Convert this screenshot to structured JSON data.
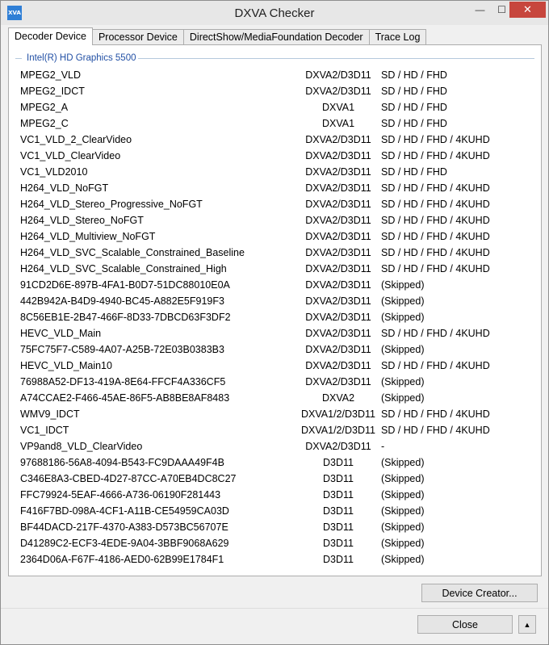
{
  "window": {
    "title": "DXVA Checker",
    "icon_label": "XVA"
  },
  "title_buttons": {
    "minimize": "—",
    "maximize": "☐",
    "close": "✕"
  },
  "tabs": [
    {
      "label": "Decoder Device"
    },
    {
      "label": "Processor Device"
    },
    {
      "label": "DirectShow/MediaFoundation Decoder"
    },
    {
      "label": "Trace Log"
    }
  ],
  "group_title": "Intel(R) HD Graphics 5500",
  "decoders": [
    {
      "name": "MPEG2_VLD",
      "api": "DXVA2/D3D11",
      "res": "SD / HD / FHD"
    },
    {
      "name": "MPEG2_IDCT",
      "api": "DXVA2/D3D11",
      "res": "SD / HD / FHD"
    },
    {
      "name": "MPEG2_A",
      "api": "DXVA1",
      "res": "SD / HD / FHD"
    },
    {
      "name": "MPEG2_C",
      "api": "DXVA1",
      "res": "SD / HD / FHD"
    },
    {
      "name": "VC1_VLD_2_ClearVideo",
      "api": "DXVA2/D3D11",
      "res": "SD / HD / FHD / 4KUHD"
    },
    {
      "name": "VC1_VLD_ClearVideo",
      "api": "DXVA2/D3D11",
      "res": "SD / HD / FHD / 4KUHD"
    },
    {
      "name": "VC1_VLD2010",
      "api": "DXVA2/D3D11",
      "res": "SD / HD / FHD"
    },
    {
      "name": "H264_VLD_NoFGT",
      "api": "DXVA2/D3D11",
      "res": "SD / HD / FHD / 4KUHD"
    },
    {
      "name": "H264_VLD_Stereo_Progressive_NoFGT",
      "api": "DXVA2/D3D11",
      "res": "SD / HD / FHD / 4KUHD"
    },
    {
      "name": "H264_VLD_Stereo_NoFGT",
      "api": "DXVA2/D3D11",
      "res": "SD / HD / FHD / 4KUHD"
    },
    {
      "name": "H264_VLD_Multiview_NoFGT",
      "api": "DXVA2/D3D11",
      "res": "SD / HD / FHD / 4KUHD"
    },
    {
      "name": "H264_VLD_SVC_Scalable_Constrained_Baseline",
      "api": "DXVA2/D3D11",
      "res": "SD / HD / FHD / 4KUHD"
    },
    {
      "name": "H264_VLD_SVC_Scalable_Constrained_High",
      "api": "DXVA2/D3D11",
      "res": "SD / HD / FHD / 4KUHD"
    },
    {
      "name": "91CD2D6E-897B-4FA1-B0D7-51DC88010E0A",
      "api": "DXVA2/D3D11",
      "res": "(Skipped)"
    },
    {
      "name": "442B942A-B4D9-4940-BC45-A882E5F919F3",
      "api": "DXVA2/D3D11",
      "res": "(Skipped)"
    },
    {
      "name": "8C56EB1E-2B47-466F-8D33-7DBCD63F3DF2",
      "api": "DXVA2/D3D11",
      "res": "(Skipped)"
    },
    {
      "name": "HEVC_VLD_Main",
      "api": "DXVA2/D3D11",
      "res": "SD / HD / FHD / 4KUHD"
    },
    {
      "name": "75FC75F7-C589-4A07-A25B-72E03B0383B3",
      "api": "DXVA2/D3D11",
      "res": "(Skipped)"
    },
    {
      "name": "HEVC_VLD_Main10",
      "api": "DXVA2/D3D11",
      "res": "SD / HD / FHD / 4KUHD"
    },
    {
      "name": "76988A52-DF13-419A-8E64-FFCF4A336CF5",
      "api": "DXVA2/D3D11",
      "res": "(Skipped)"
    },
    {
      "name": "A74CCAE2-F466-45AE-86F5-AB8BE8AF8483",
      "api": "DXVA2",
      "res": "(Skipped)"
    },
    {
      "name": "WMV9_IDCT",
      "api": "DXVA1/2/D3D11",
      "res": "SD / HD / FHD / 4KUHD"
    },
    {
      "name": "VC1_IDCT",
      "api": "DXVA1/2/D3D11",
      "res": "SD / HD / FHD / 4KUHD"
    },
    {
      "name": "VP9and8_VLD_ClearVideo",
      "api": "DXVA2/D3D11",
      "res": "-"
    },
    {
      "name": "97688186-56A8-4094-B543-FC9DAAA49F4B",
      "api": "D3D11",
      "res": "(Skipped)"
    },
    {
      "name": "C346E8A3-CBED-4D27-87CC-A70EB4DC8C27",
      "api": "D3D11",
      "res": "(Skipped)"
    },
    {
      "name": "FFC79924-5EAF-4666-A736-06190F281443",
      "api": "D3D11",
      "res": "(Skipped)"
    },
    {
      "name": "F416F7BD-098A-4CF1-A11B-CE54959CA03D",
      "api": "D3D11",
      "res": "(Skipped)"
    },
    {
      "name": "BF44DACD-217F-4370-A383-D573BC56707E",
      "api": "D3D11",
      "res": "(Skipped)"
    },
    {
      "name": "D41289C2-ECF3-4EDE-9A04-3BBF9068A629",
      "api": "D3D11",
      "res": "(Skipped)"
    },
    {
      "name": "2364D06A-F67F-4186-AED0-62B99E1784F1",
      "api": "D3D11",
      "res": "(Skipped)"
    }
  ],
  "buttons": {
    "device_creator": "Device Creator...",
    "close": "Close",
    "collapse_icon": "▲"
  }
}
